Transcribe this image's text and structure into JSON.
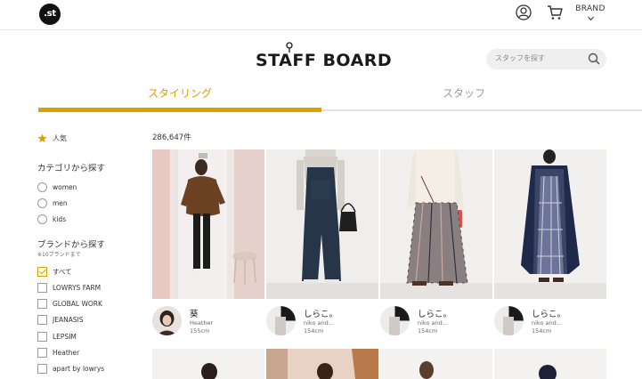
{
  "header": {
    "logo_text": ".st",
    "brand_label": "BRAND",
    "user_icon": "user-icon",
    "cart_icon": "cart-icon"
  },
  "site": {
    "title": "STAFF BOARD"
  },
  "search": {
    "placeholder": "スタッフを探す",
    "icon": "search-icon"
  },
  "tabs": [
    {
      "label": "スタイリング",
      "active": true
    },
    {
      "label": "スタッフ",
      "active": false
    }
  ],
  "colors": {
    "accent": "#d8a200",
    "text": "#333333",
    "muted": "#9a9a9a"
  },
  "sidebar": {
    "popular_label": "人気",
    "category_title": "カテゴリから探す",
    "categories": [
      "women",
      "men",
      "kids"
    ],
    "brand_title": "ブランドから探す",
    "brand_note": "※10ブランドまで",
    "brands": [
      {
        "label": "すべて",
        "checked": true
      },
      {
        "label": "LOWRYS FARM",
        "checked": false
      },
      {
        "label": "GLOBAL WORK",
        "checked": false
      },
      {
        "label": "JEANASIS",
        "checked": false
      },
      {
        "label": "LEPSIM",
        "checked": false
      },
      {
        "label": "Heather",
        "checked": false
      },
      {
        "label": "apart by lowrys",
        "checked": false
      }
    ]
  },
  "results": {
    "count": "286,647件",
    "cards": [
      {
        "name": "葵",
        "shop": "Heather",
        "height": "155cm"
      },
      {
        "name": "しらこ。",
        "shop": "niko and...",
        "height": "154cm"
      },
      {
        "name": "しらこ。",
        "shop": "niko and...",
        "height": "154cm"
      },
      {
        "name": "しらこ。",
        "shop": "niko and...",
        "height": "154cm"
      }
    ]
  }
}
